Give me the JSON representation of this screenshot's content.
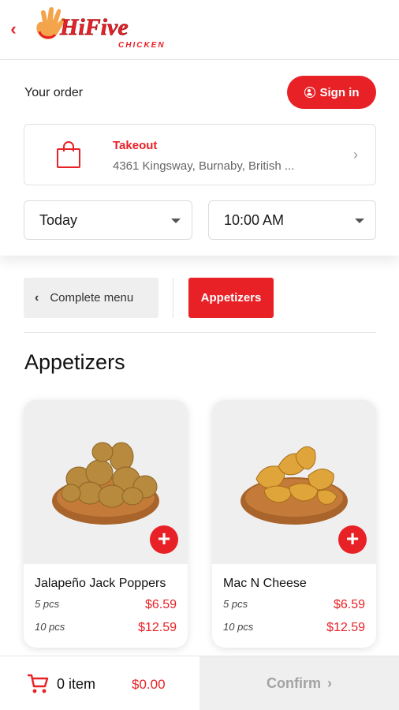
{
  "header": {
    "back_icon": "chevron-left-icon",
    "logo_text": "HiFive",
    "logo_subtext": "CHICKEN"
  },
  "order": {
    "heading": "Your order",
    "signin_label": "Sign in",
    "signin_icon": "user-circle-icon",
    "takeout": {
      "icon": "shopping-bag-icon",
      "title": "Takeout",
      "address": "4361 Kingsway, Burnaby, British ..."
    },
    "day_select": "Today",
    "time_select": "10:00 AM"
  },
  "menu_nav": {
    "back_label": "Complete menu",
    "active_category": "Appetizers"
  },
  "section_title": "Appetizers",
  "products": [
    {
      "name": "Jalapeño Jack Poppers",
      "options": [
        {
          "size": "5 pcs",
          "price": "$6.59"
        },
        {
          "size": "10 pcs",
          "price": "$12.59"
        }
      ]
    },
    {
      "name": "Mac N Cheese",
      "options": [
        {
          "size": "5 pcs",
          "price": "$6.59"
        },
        {
          "size": "10 pcs",
          "price": "$12.59"
        }
      ]
    }
  ],
  "cart": {
    "icon": "cart-icon",
    "item_count": "0 item",
    "total": "$0.00",
    "confirm_label": "Confirm"
  },
  "colors": {
    "brand_red": "#e82127",
    "panel_gray": "#efefef"
  }
}
